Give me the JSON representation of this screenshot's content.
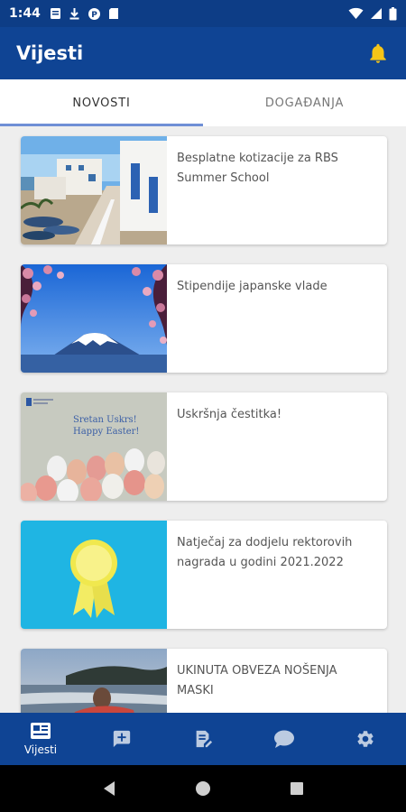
{
  "status_bar": {
    "time": "1:44"
  },
  "app_bar": {
    "title": "Vijesti",
    "notification_icon": "bell-icon",
    "accent": "#f5c518"
  },
  "tabs": [
    {
      "label": "NOVOSTI",
      "active": true
    },
    {
      "label": "DOGAĐANJA",
      "active": false
    }
  ],
  "news": [
    {
      "title": "Besplatne kotizacije za RBS Summer School",
      "thumbnail": "coastal-town-image"
    },
    {
      "title": "Stipendije japanske vlade",
      "thumbnail": "mount-fuji-image"
    },
    {
      "title": "Uskršnja čestitka!",
      "thumbnail": "easter-eggs-image",
      "thumb_text_1": "Sretan Uskrs!",
      "thumb_text_2": "Happy Easter!"
    },
    {
      "title": "Natječaj za dodjelu rektorovih nagrada u godini 2021.2022",
      "thumbnail": "award-ribbon-image"
    },
    {
      "title": "UKINUTA OBVEZA NOŠENJA MASKI",
      "thumbnail": "beach-sunset-image"
    }
  ],
  "bottom_nav": [
    {
      "label": "Vijesti",
      "icon": "news-icon",
      "active": true
    },
    {
      "label": "",
      "icon": "add-comment-icon",
      "active": false
    },
    {
      "label": "",
      "icon": "edit-document-icon",
      "active": false
    },
    {
      "label": "",
      "icon": "chat-icon",
      "active": false
    },
    {
      "label": "",
      "icon": "settings-icon",
      "active": false
    }
  ],
  "colors": {
    "primary": "#0f4494",
    "status_bar": "#0d3d86",
    "tab_indicator": "#6f8fd6"
  }
}
